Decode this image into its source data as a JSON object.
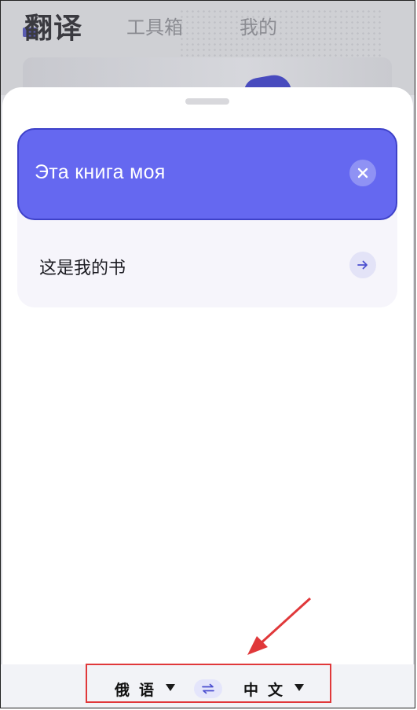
{
  "header": {
    "tabs": [
      {
        "label": "翻译",
        "active": true
      },
      {
        "label": "工具箱",
        "active": false
      },
      {
        "label": "我的",
        "active": false
      }
    ]
  },
  "translation": {
    "source_text": "Эта книга моя",
    "result_text": "这是我的书"
  },
  "language_bar": {
    "source_language": "俄语",
    "target_language": "中文"
  },
  "icons": {
    "clear": "close-icon",
    "go": "arrow-right-icon",
    "swap": "swap-icon",
    "dropdown": "caret-down-icon"
  },
  "colors": {
    "accent": "#6568f0",
    "accent_border": "#3e41c9",
    "highlight": "#e0383a"
  }
}
